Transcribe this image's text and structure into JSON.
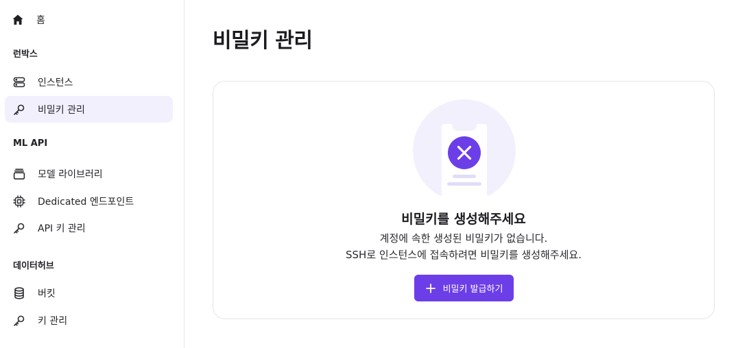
{
  "sidebar": {
    "home": {
      "label": "홈",
      "icon": "home-icon"
    },
    "sections": [
      {
        "title": "런박스"
      },
      {
        "title": "ML API"
      },
      {
        "title": "데이터허브"
      }
    ],
    "items": [
      {
        "label": "인스턴스",
        "icon": "server-icon"
      },
      {
        "label": "비밀키 관리",
        "icon": "key-icon",
        "active": true
      },
      {
        "label": "모델 라이브러리",
        "icon": "stack-icon"
      },
      {
        "label": "Dedicated 엔드포인트",
        "icon": "chip-icon"
      },
      {
        "label": "API 키 관리",
        "icon": "key-icon"
      },
      {
        "label": "버킷",
        "icon": "database-icon"
      },
      {
        "label": "키 관리",
        "icon": "key-icon"
      }
    ]
  },
  "main": {
    "title": "비밀키 관리",
    "empty_state": {
      "title": "비밀키를 생성해주세요",
      "line1": "계정에 속한 생성된 비밀키가 없습니다.",
      "line2": "SSH로 인스턴스에 접속하려면 비밀키를 생성해주세요.",
      "button_label": "비밀키 발급하기",
      "illustration": "key-error-illustration"
    }
  },
  "colors": {
    "accent": "#6c3ee8",
    "active_bg": "#f2f0fd",
    "illus_bg": "#f3f0fd"
  }
}
